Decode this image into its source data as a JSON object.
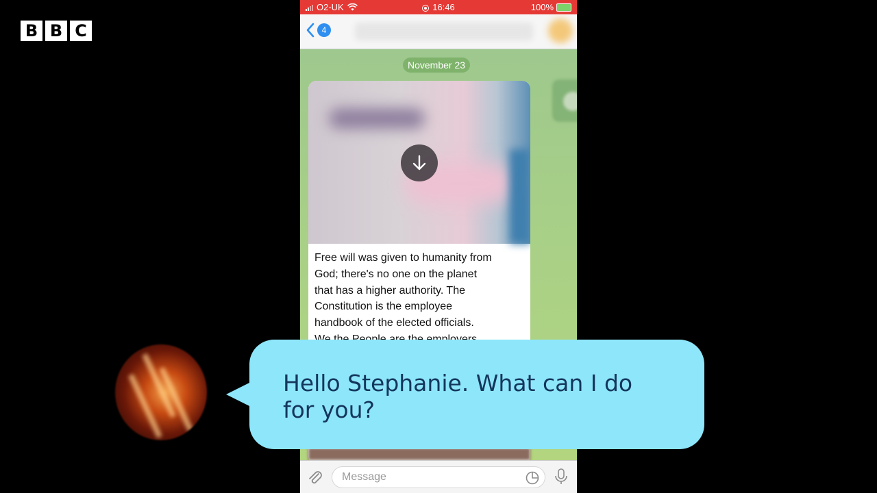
{
  "logo": {
    "letters": [
      "B",
      "B",
      "C"
    ]
  },
  "status_bar": {
    "carrier": "O2-UK",
    "time": "16:46",
    "battery": "100%",
    "color": "#e53935"
  },
  "nav": {
    "back_count": "4"
  },
  "chat": {
    "date": "November 23",
    "message_text": "Free will was given to humanity from\nGod; there's no one on the planet\nthat has a higher authority. The\nConstitution is the employee\nhandbook of the elected officials.\nWe the People are the employers."
  },
  "input": {
    "placeholder": "Message"
  },
  "caption": {
    "text": "Hello Stephanie. What can I do for you?",
    "bubble_color": "#8ee6fb"
  },
  "icons": [
    "back-chevron-icon",
    "download-icon",
    "paperclip-icon",
    "sticker-icon",
    "microphone-icon",
    "wifi-icon",
    "signal-icon",
    "battery-icon"
  ]
}
